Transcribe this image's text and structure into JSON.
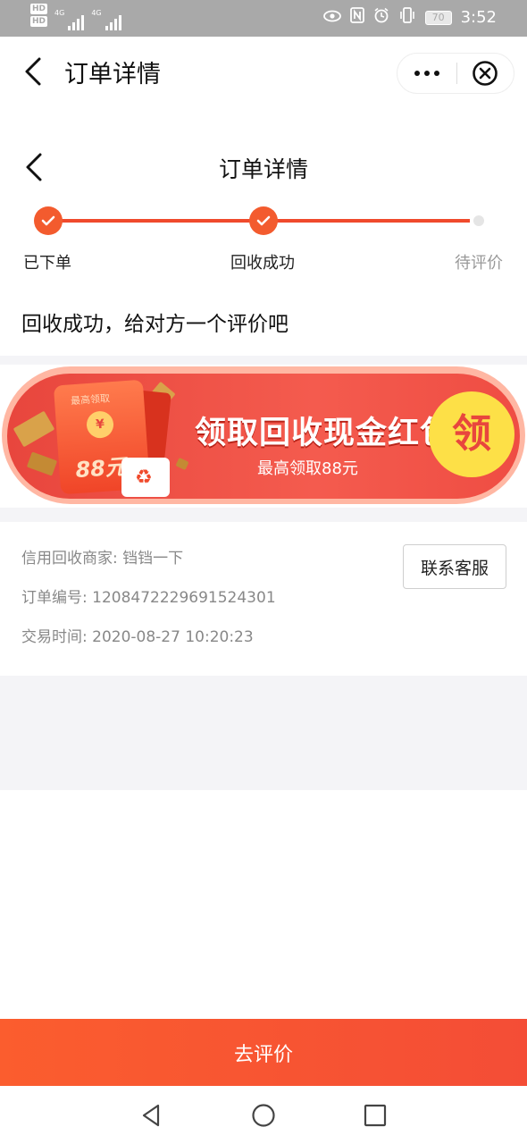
{
  "status_bar": {
    "hd1": "HD",
    "hd2": "HD",
    "net1": "4G",
    "net2": "4G",
    "battery": "70",
    "time": "3:52",
    "icons": [
      "eye-icon",
      "nfc-icon",
      "alarm-icon",
      "vibrate-icon"
    ]
  },
  "mini_header": {
    "title": "订单详情",
    "icons": [
      "back-arrow-icon",
      "more-dots-icon",
      "close-circle-icon"
    ]
  },
  "page": {
    "title": "订单详情",
    "steps": [
      {
        "label": "已下单",
        "done": true
      },
      {
        "label": "回收成功",
        "done": true
      },
      {
        "label": "待评价",
        "done": false
      }
    ],
    "status_text": "回收成功，给对方一个评价吧"
  },
  "banner": {
    "envelope_caption": "最高领取",
    "envelope_amount": "88元",
    "title": "领取回收现金红包",
    "subtitle": "最高领取88元",
    "button": "领"
  },
  "info": {
    "merchant": "信用回收商家: 铛铛一下",
    "order_no": "订单编号: 1208472229691524301",
    "time": "交易时间: 2020-08-27 10:20:23",
    "contact_button": "联系客服"
  },
  "bottom": {
    "button": "去评价"
  },
  "colors": {
    "accent": "#f35b2e",
    "progress_line": "#f04a2c",
    "banner_red": "#e8463d",
    "banner_yellow": "#fde047"
  }
}
